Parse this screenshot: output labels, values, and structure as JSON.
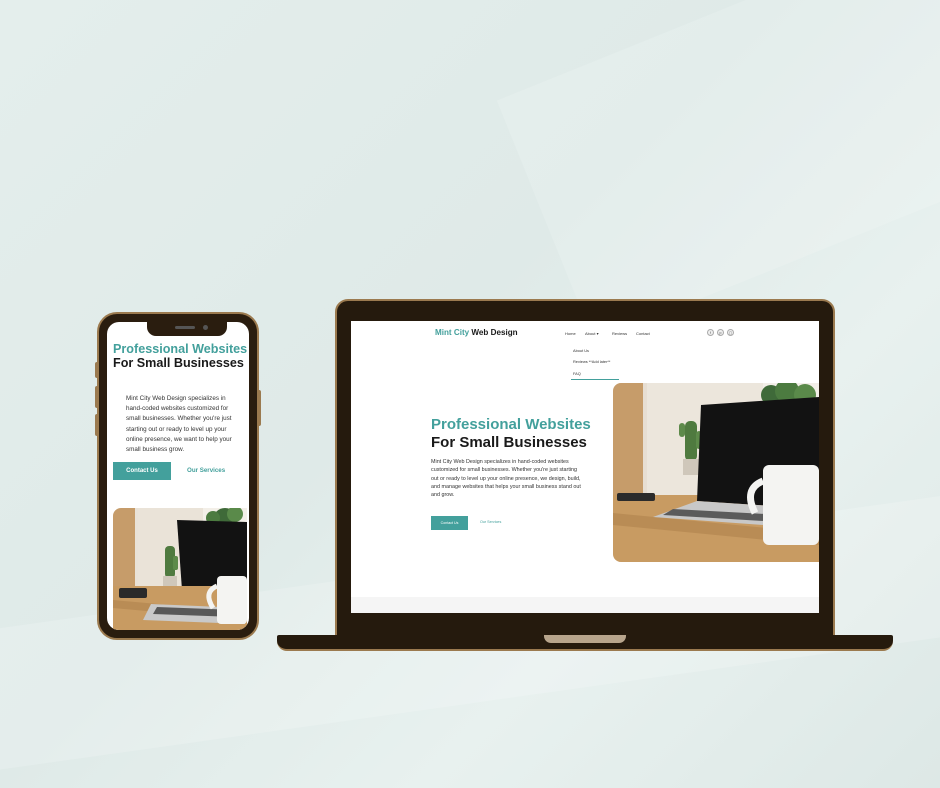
{
  "site": {
    "logo_part1": "Mint City",
    "logo_part2": "Web Design",
    "nav": {
      "home": "Home",
      "about": "About",
      "reviews": "Reviews",
      "contact": "Contact"
    },
    "dropdown": {
      "items": [
        "About Us",
        "Reviews **Add later**",
        "FAQ"
      ]
    },
    "social_icons": [
      "facebook-icon",
      "pinterest-icon",
      "instagram-icon"
    ],
    "hero": {
      "title_line1": "Professional Websites",
      "title_line2": "For Small Businesses",
      "description_desktop": "Mint City Web Design specializes in hand-coded websites customized for small businesses. Whether you're just starting out or ready to level up your online presence, we design, build, and manage websites that helps your small business stand out and grow.",
      "description_mobile": "Mint City Web Design specializes in hand-coded websites customized for small businesses. Whether you're just starting out or ready to level up your online presence, we want to help your small business grow.",
      "contact_button": "Contact Us",
      "services_button": "Our Services"
    }
  },
  "colors": {
    "accent": "#43a09c",
    "text_dark": "#1a1a1a",
    "device_frame": "#251a0d",
    "device_trim": "#9b7a4f"
  }
}
